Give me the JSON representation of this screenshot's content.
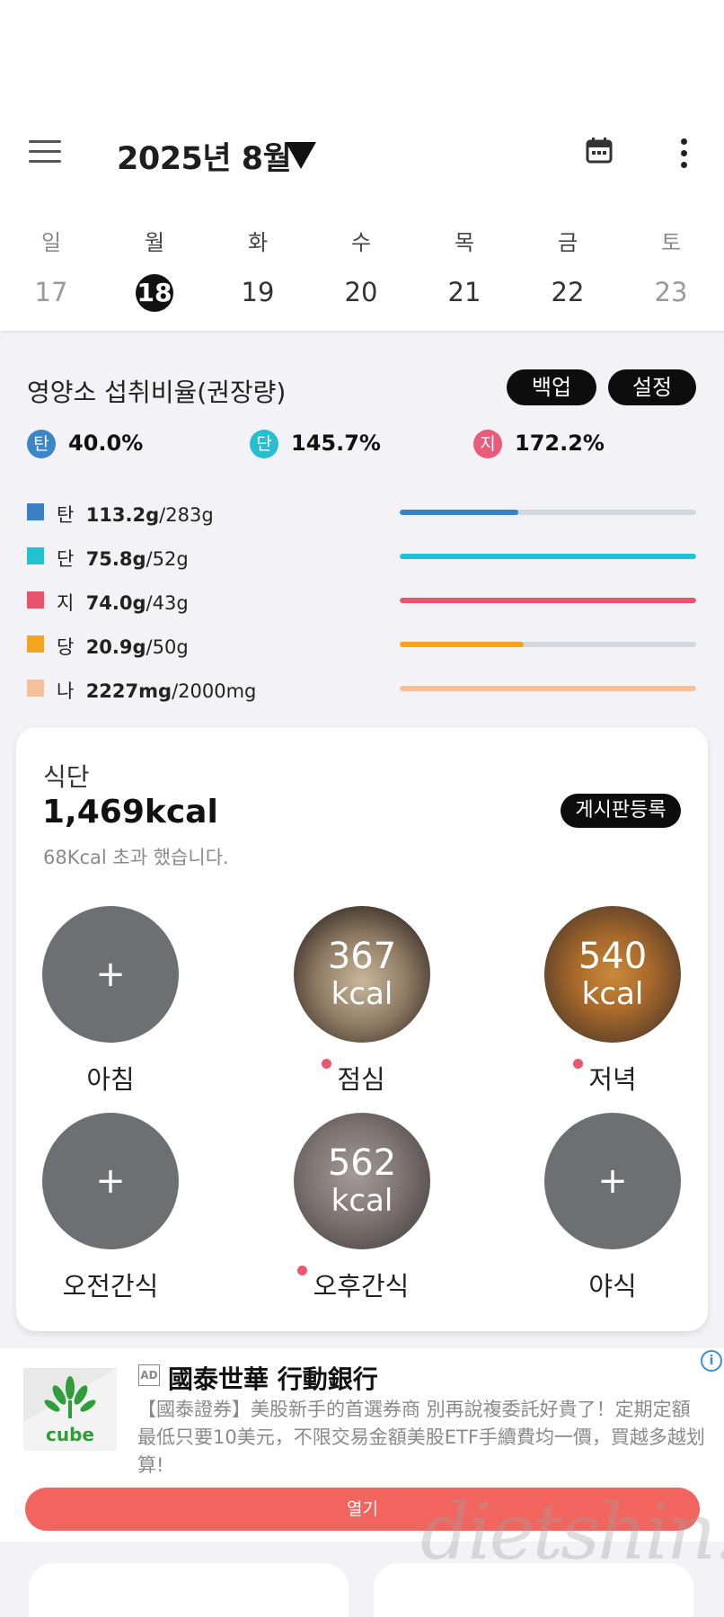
{
  "header": {
    "month_title": "2025년 8월",
    "menu_icon": "hamburger-menu-icon",
    "calendar_icon": "calendar-icon",
    "more_icon": "more-vertical-icon"
  },
  "week": {
    "weekdays": [
      "일",
      "월",
      "화",
      "수",
      "목",
      "금",
      "토"
    ],
    "dates": [
      "17",
      "18",
      "19",
      "20",
      "21",
      "22",
      "23"
    ],
    "selected": "18"
  },
  "nutrients": {
    "title": "영양소 섭취비율(권장량)",
    "backup_label": "백업",
    "settings_label": "설정",
    "ratios": [
      {
        "badge": "탄",
        "value": "40.0%",
        "color": "#3b86c8"
      },
      {
        "badge": "단",
        "value": "145.7%",
        "color": "#27bfd0"
      },
      {
        "badge": "지",
        "value": "172.2%",
        "color": "#ea5b7a"
      }
    ],
    "rows": [
      {
        "name": "탄",
        "amount": "113.2g",
        "goal": "/283g",
        "color": "#3b7fc6",
        "progress": 0.4
      },
      {
        "name": "단",
        "amount": "75.8g",
        "goal": "/52g",
        "color": "#22c1d2",
        "progress": 1.0
      },
      {
        "name": "지",
        "amount": "74.0g",
        "goal": "/43g",
        "color": "#e9546c",
        "progress": 1.0
      },
      {
        "name": "당",
        "amount": "20.9g",
        "goal": "/50g",
        "color": "#f4a51d",
        "progress": 0.418
      },
      {
        "name": "나",
        "amount": "2227mg",
        "goal": "/2000mg",
        "color": "#f5c09a",
        "progress": 1.0
      }
    ]
  },
  "diet": {
    "title": "식단",
    "total_kcal": "1,469kcal",
    "note": "68Kcal 초과 했습니다.",
    "board_button": "게시판등록",
    "meals": [
      {
        "label": "아침",
        "kcal": "",
        "unit": "",
        "plus": "+",
        "has_photo": false,
        "dot": false
      },
      {
        "label": "점심",
        "kcal": "367",
        "unit": "kcal",
        "plus": "",
        "has_photo": true,
        "dot": true
      },
      {
        "label": "저녁",
        "kcal": "540",
        "unit": "kcal",
        "plus": "",
        "has_photo": true,
        "dot": true
      },
      {
        "label": "오전간식",
        "kcal": "",
        "unit": "",
        "plus": "+",
        "has_photo": false,
        "dot": false
      },
      {
        "label": "오후간식",
        "kcal": "562",
        "unit": "kcal",
        "plus": "",
        "has_photo": true,
        "dot": true
      },
      {
        "label": "야식",
        "kcal": "",
        "unit": "",
        "plus": "+",
        "has_photo": false,
        "dot": false
      }
    ]
  },
  "ad": {
    "badge": "AD",
    "title": "國泰世華 行動銀行",
    "body": "【國泰證券】美股新手的首選券商 別再說複委託好貴了！定期定額最低只要10美元，不限交易金額美股ETF手續費均一價，買越多越划算!",
    "logo_text": "cube",
    "open_label": "열기",
    "info_icon": "info-icon"
  },
  "watermark": "dietshin.com"
}
